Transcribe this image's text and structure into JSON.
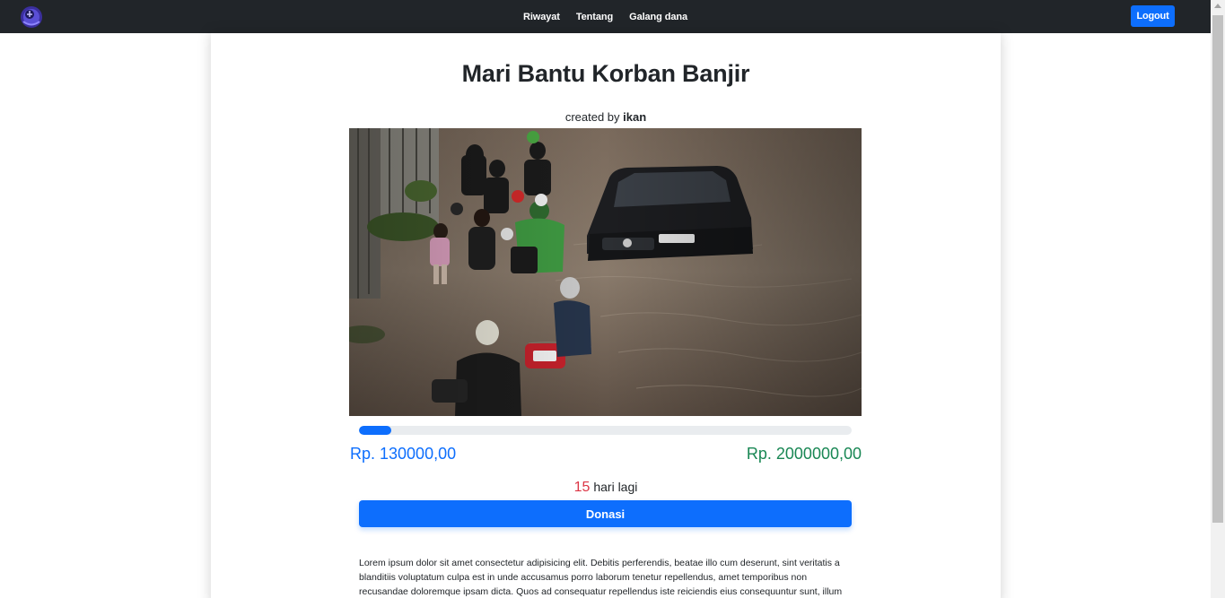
{
  "navbar": {
    "links": [
      "Riwayat",
      "Tentang",
      "Galang dana"
    ],
    "logout_label": "Logout"
  },
  "campaign": {
    "title": "Mari Bantu Korban Banjir",
    "created_prefix": "created by",
    "creator": "ikan",
    "image_alt": "Flood victims walking through flooded street",
    "raised": "Rp. 130000,00",
    "target": "Rp. 2000000,00",
    "progress_fraction": 0.065,
    "days_left": "15",
    "days_suffix": "hari lagi",
    "donate_label": "Donasi",
    "description": "Lorem ipsum dolor sit amet consectetur adipisicing elit. Debitis perferendis, beatae illo cum deserunt, sint veritatis a blanditiis voluptatum culpa est in unde accusamus porro laborum tenetur repellendus, amet temporibus non recusandae doloremque ipsam dicta. Quos ad consequatur repellendus iste reiciendis eius consequuntur sunt, illum"
  },
  "colors": {
    "navbar": "#212529",
    "primary": "#0d6efd",
    "success": "#198754",
    "danger": "#dc3545"
  }
}
